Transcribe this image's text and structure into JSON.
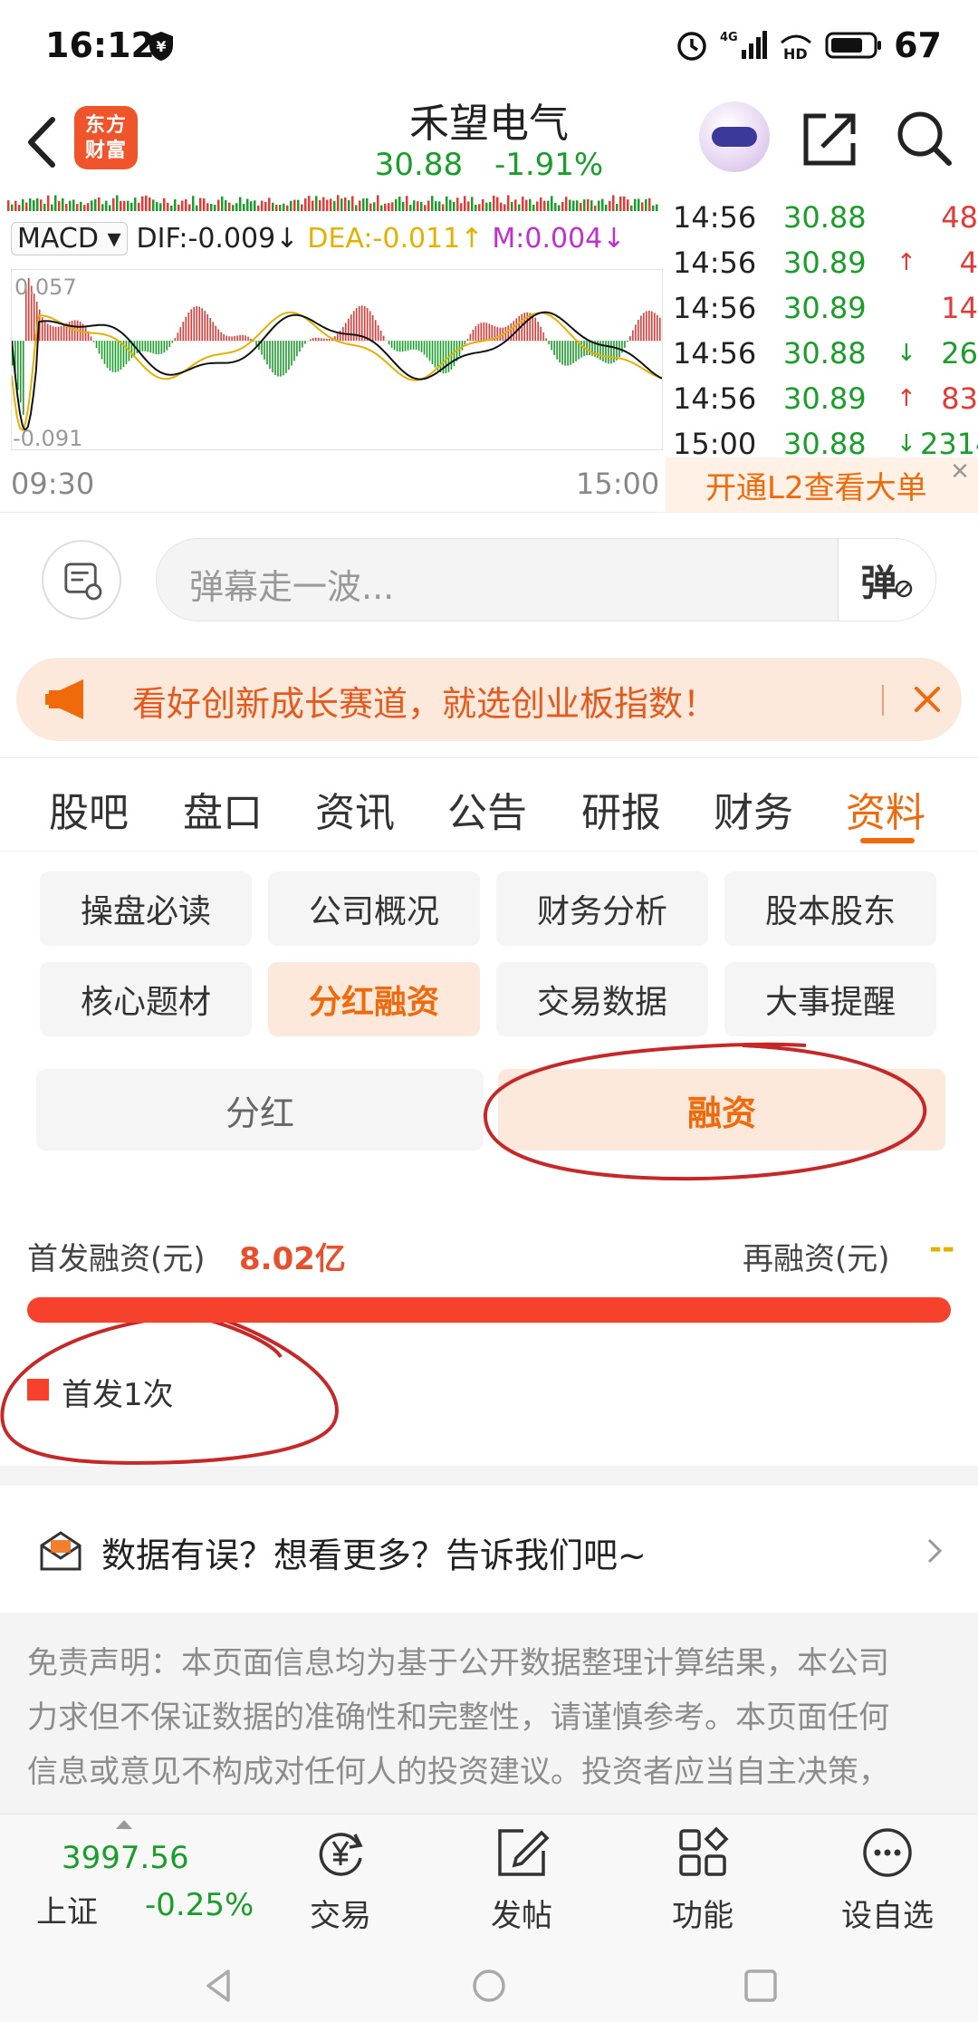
{
  "status_bar": {
    "time": "16:12",
    "network": "4G",
    "battery": "67"
  },
  "header": {
    "logo_line1": "东方",
    "logo_line2": "财富",
    "stock_name": "禾望电气",
    "price": "30.88",
    "change_pct": "-1.91%"
  },
  "macd": {
    "selector": "MACD ▾",
    "dif": "DIF:-0.009",
    "dif_arrow": "↓",
    "dea": "DEA:-0.011",
    "dea_arrow": "↑",
    "m": "M:0.004",
    "m_arrow": "↓",
    "top_value": "0.057",
    "bottom_value": "-0.091",
    "time_start": "09:30",
    "time_end": "15:00"
  },
  "ticks": [
    {
      "time": "14:56",
      "price": "30.88",
      "arrow": "",
      "vol": "48",
      "dir": "up"
    },
    {
      "time": "14:56",
      "price": "30.89",
      "arrow": "↑",
      "vol": "4",
      "dir": "up"
    },
    {
      "time": "14:56",
      "price": "30.89",
      "arrow": "",
      "vol": "14",
      "dir": "up"
    },
    {
      "time": "14:56",
      "price": "30.88",
      "arrow": "↓",
      "vol": "26",
      "dir": "down"
    },
    {
      "time": "14:56",
      "price": "30.89",
      "arrow": "↑",
      "vol": "83",
      "dir": "up"
    },
    {
      "time": "15:00",
      "price": "30.88",
      "arrow": "↓",
      "vol": "2314",
      "dir": "down"
    }
  ],
  "l2_banner": {
    "text": "开通L2查看大单",
    "close": "✕"
  },
  "danmu": {
    "placeholder": "弹幕走一波...",
    "send_label": "弹"
  },
  "ad": {
    "text": "看好创新成长赛道，就选创业板指数！"
  },
  "tabs": [
    "股吧",
    "盘口",
    "资讯",
    "公告",
    "研报",
    "财务",
    "资料"
  ],
  "active_tab": "资料",
  "subnav": [
    {
      "label": "操盘必读",
      "active": false
    },
    {
      "label": "公司概况",
      "active": false
    },
    {
      "label": "财务分析",
      "active": false
    },
    {
      "label": "股本股东",
      "active": false
    },
    {
      "label": "核心题材",
      "active": false
    },
    {
      "label": "分红融资",
      "active": true
    },
    {
      "label": "交易数据",
      "active": false
    },
    {
      "label": "大事提醒",
      "active": false
    }
  ],
  "segment": {
    "left": "分红",
    "right": "融资",
    "active": "融资"
  },
  "financing": {
    "ipo_label": "首发融资(元)",
    "ipo_value": "8.02亿",
    "refi_label": "再融资(元)",
    "refi_value": "--",
    "ipo_share": 1.0,
    "legend": "首发1次",
    "bar_color": "#f6422c"
  },
  "feedback": {
    "text": "数据有误？想看更多？告诉我们吧~"
  },
  "disclaimer": {
    "lines": [
      "免责声明：本页面信息均为基于公开数据整理计算结果，本公司",
      "力求但不保证数据的准确性和完整性，请谨慎参考。本页面任何",
      "信息或意见不构成对任何人的投资建议。投资者应当自主决策，"
    ]
  },
  "bottom_nav": {
    "index_value": "3997.56",
    "index_name": "上证",
    "index_change": "-0.25%",
    "items": [
      {
        "label": "交易",
        "icon": "yen-cycle-icon"
      },
      {
        "label": "发帖",
        "icon": "edit-icon"
      },
      {
        "label": "功能",
        "icon": "grid-icon"
      },
      {
        "label": "设自选",
        "icon": "more-icon"
      }
    ]
  },
  "colors": {
    "accent": "#f06a0c",
    "up": "#e53935",
    "down": "#1a9e2a",
    "dea": "#e3b100",
    "m": "#c02fcf"
  }
}
